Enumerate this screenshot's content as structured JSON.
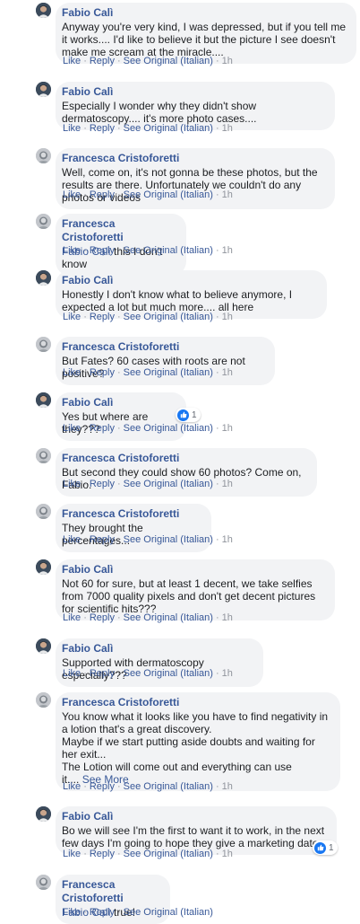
{
  "actions": {
    "like": "Like",
    "reply": "Reply",
    "see_original": "See Original (Italian)",
    "separator": "·"
  },
  "comments": [
    {
      "author": "Fabio Calì",
      "avatar": "fabio",
      "text": "Anyway you're very kind, I was depressed, but if you tell me it works.... I'd like to believe it but the picture I see doesn't make me scream at the miracle....",
      "time": "1h"
    },
    {
      "author": "Fabio Calì",
      "avatar": "fabio",
      "text": "Especially I wonder why they didn't show dermatoscopy.... it's more photo cases....",
      "time": "1h"
    },
    {
      "author": "Francesca Cristoforetti",
      "avatar": "francesca",
      "text": "Well, come on, it's not gonna be these photos, but the results are there. Unfortunately we couldn't do any photos or videos",
      "time": "1h"
    },
    {
      "author": "Francesca Cristoforetti",
      "avatar": "francesca",
      "mention": "Fabio Calì",
      "text": " this I don't know",
      "time": "1h"
    },
    {
      "author": "Fabio Calì",
      "avatar": "fabio",
      "text": "Honestly I don't know what to believe anymore, I expected a lot but much more.... all here",
      "time": "1h"
    },
    {
      "author": "Francesca Cristoforetti",
      "avatar": "francesca",
      "text": "But Fates? 60 cases with roots are not positive?",
      "time": "1h"
    },
    {
      "author": "Fabio Calì",
      "avatar": "fabio",
      "text": "Yes but where are they???",
      "time": "1h",
      "reactions": "1"
    },
    {
      "author": "Francesca Cristoforetti",
      "avatar": "francesca",
      "text": "But second they could show 60 photos? Come on, Fabio.",
      "time": "1h"
    },
    {
      "author": "Francesca Cristoforetti",
      "avatar": "francesca",
      "text": "They brought the percentages...",
      "time": "1h"
    },
    {
      "author": "Fabio Calì",
      "avatar": "fabio",
      "text": "Not 60 for sure, but at least 1 decent, we take selfies from 7000 quality pixels and don't get decent pictures for scientific hits???",
      "time": "1h"
    },
    {
      "author": "Fabio Calì",
      "avatar": "fabio",
      "text": "Supported with dermatoscopy especially???",
      "time": "1h"
    },
    {
      "author": "Francesca Cristoforetti",
      "avatar": "francesca",
      "text": "You know what it looks like you have to find negativity in a lotion that's a great discovery.\nMaybe if we start putting aside doubts and waiting for her exit...\nThe Lotion will come out and everything can use\nit....",
      "see_more": "See More",
      "time": "1h"
    },
    {
      "author": "Fabio Calì",
      "avatar": "fabio",
      "text": "Bo we will see I'm the first to want it to work, in the next few days I'm going to hope they give a marketing date",
      "time": "1h",
      "reactions": "1"
    },
    {
      "author": "Francesca Cristoforetti",
      "avatar": "francesca",
      "mention": "Fabio Calì",
      "text": " true!",
      "time": ""
    }
  ]
}
